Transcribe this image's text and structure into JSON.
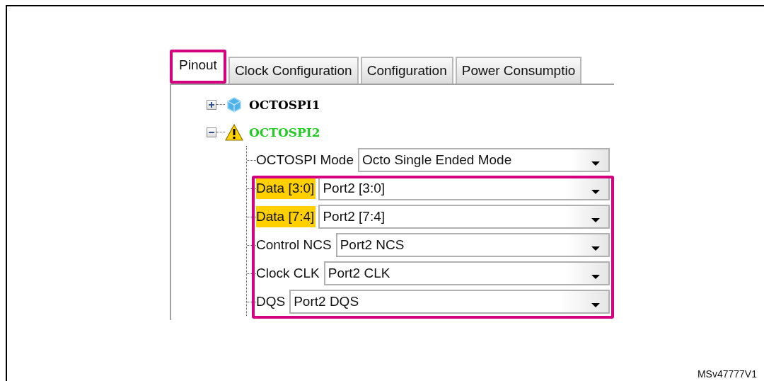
{
  "tabs": [
    {
      "label": "Pinout",
      "selected": true,
      "annotated": true
    },
    {
      "label": "Clock Configuration",
      "selected": false,
      "annotated": false
    },
    {
      "label": "Configuration",
      "selected": false,
      "annotated": false
    },
    {
      "label": "Power Consumptio",
      "selected": false,
      "annotated": false
    }
  ],
  "tree": [
    {
      "label": "OCTOSPI1",
      "kind": "peripheral",
      "expanded": false,
      "color": "#000000"
    },
    {
      "label": "OCTOSPI2",
      "kind": "warning",
      "expanded": true,
      "color": "#22cc22",
      "settings": [
        {
          "label": "OCTOSPI Mode",
          "value": "Octo Single Ended Mode",
          "highlighted": false
        }
      ],
      "pin_settings": {
        "annotated": true,
        "rows": [
          {
            "label": "Data [3:0]",
            "value": "Port2 [3:0]",
            "highlighted": true
          },
          {
            "label": "Data [7:4]",
            "value": "Port2 [7:4]",
            "highlighted": true
          },
          {
            "label": "Control NCS",
            "value": "Port2 NCS",
            "highlighted": false
          },
          {
            "label": "Clock CLK",
            "value": "Port2 CLK",
            "highlighted": false
          },
          {
            "label": "DQS",
            "value": "Port2 DQS",
            "highlighted": false
          }
        ]
      }
    }
  ],
  "figure_id": "MSv47777V1"
}
